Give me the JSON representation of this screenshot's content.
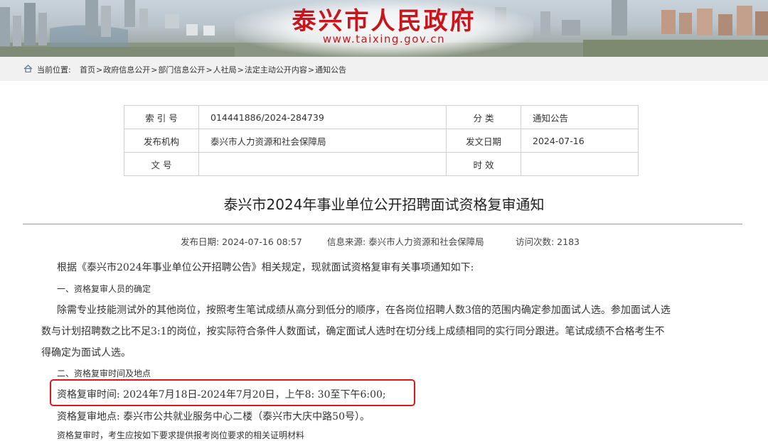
{
  "header": {
    "site_title": "泰兴市人民政府",
    "site_url": "www.taixing.gov.cn"
  },
  "breadcrumb": {
    "label": "当前位置:",
    "items": [
      "首页",
      "政府信息公开",
      "部门信息公开",
      "人社局",
      "法定主动公开内容",
      "通知公告"
    ],
    "separator": ">"
  },
  "meta_table": {
    "index_label": "索 引 号",
    "index_value": "014441886/2024-284739",
    "category_label": "分  类",
    "category_value": "通知公告",
    "publisher_label": "发布机构",
    "publisher_value": "泰兴市人力资源和社会保障局",
    "issue_date_label": "发文日期",
    "issue_date_value": "2024-07-16",
    "doc_no_label": "文  号",
    "doc_no_value": "",
    "validity_label": "时  效",
    "validity_value": ""
  },
  "article": {
    "title": "泰兴市2024年事业单位公开招聘面试资格复审通知",
    "publish_date": "发布日期:  2024-07-16 08:57",
    "source": "信息来源:  泰兴市人力资源和社会保障局",
    "visits": "访问次数:  2183",
    "intro": "根据《泰兴市2024年事业单位公开招聘公告》相关规定，现就面试资格复审有关事项通知如下:",
    "section1_heading": "一、资格复审人员的确定",
    "section1_line1": "除需专业技能测试外的其他岗位，按照考生笔试成绩从高分到低分的顺序，在各岗位招聘人数3倍的范围内确定参加面试人选。参加面试人选",
    "section1_line2": "数与计划招聘数之比不足3:1的岗位，按实际符合条件人数面试，确定面试人选时在切分线上成绩相同的实行同分跟进。笔试成绩不合格考生不",
    "section1_line3": "得确定为面试人选。",
    "section2_heading": "二、资格复审时间及地点",
    "review_time": "资格复审时间: 2024年7月18日-2024年7月20日，上午8: 30至下午6:00;",
    "review_place": "资格复审地点: 泰兴市公共就业服务中心二楼（泰兴市大庆中路50号）。",
    "cut_line": "资格复审时，考生应按如下要求提供报考岗位要求的相关证明材料"
  },
  "colors": {
    "brand_red": "#c8161d",
    "highlight_red": "#e0161b",
    "breadcrumb_bg": "#f1f1f1",
    "table_border": "#cfcfcf"
  },
  "icons": {
    "home": "home-icon"
  }
}
